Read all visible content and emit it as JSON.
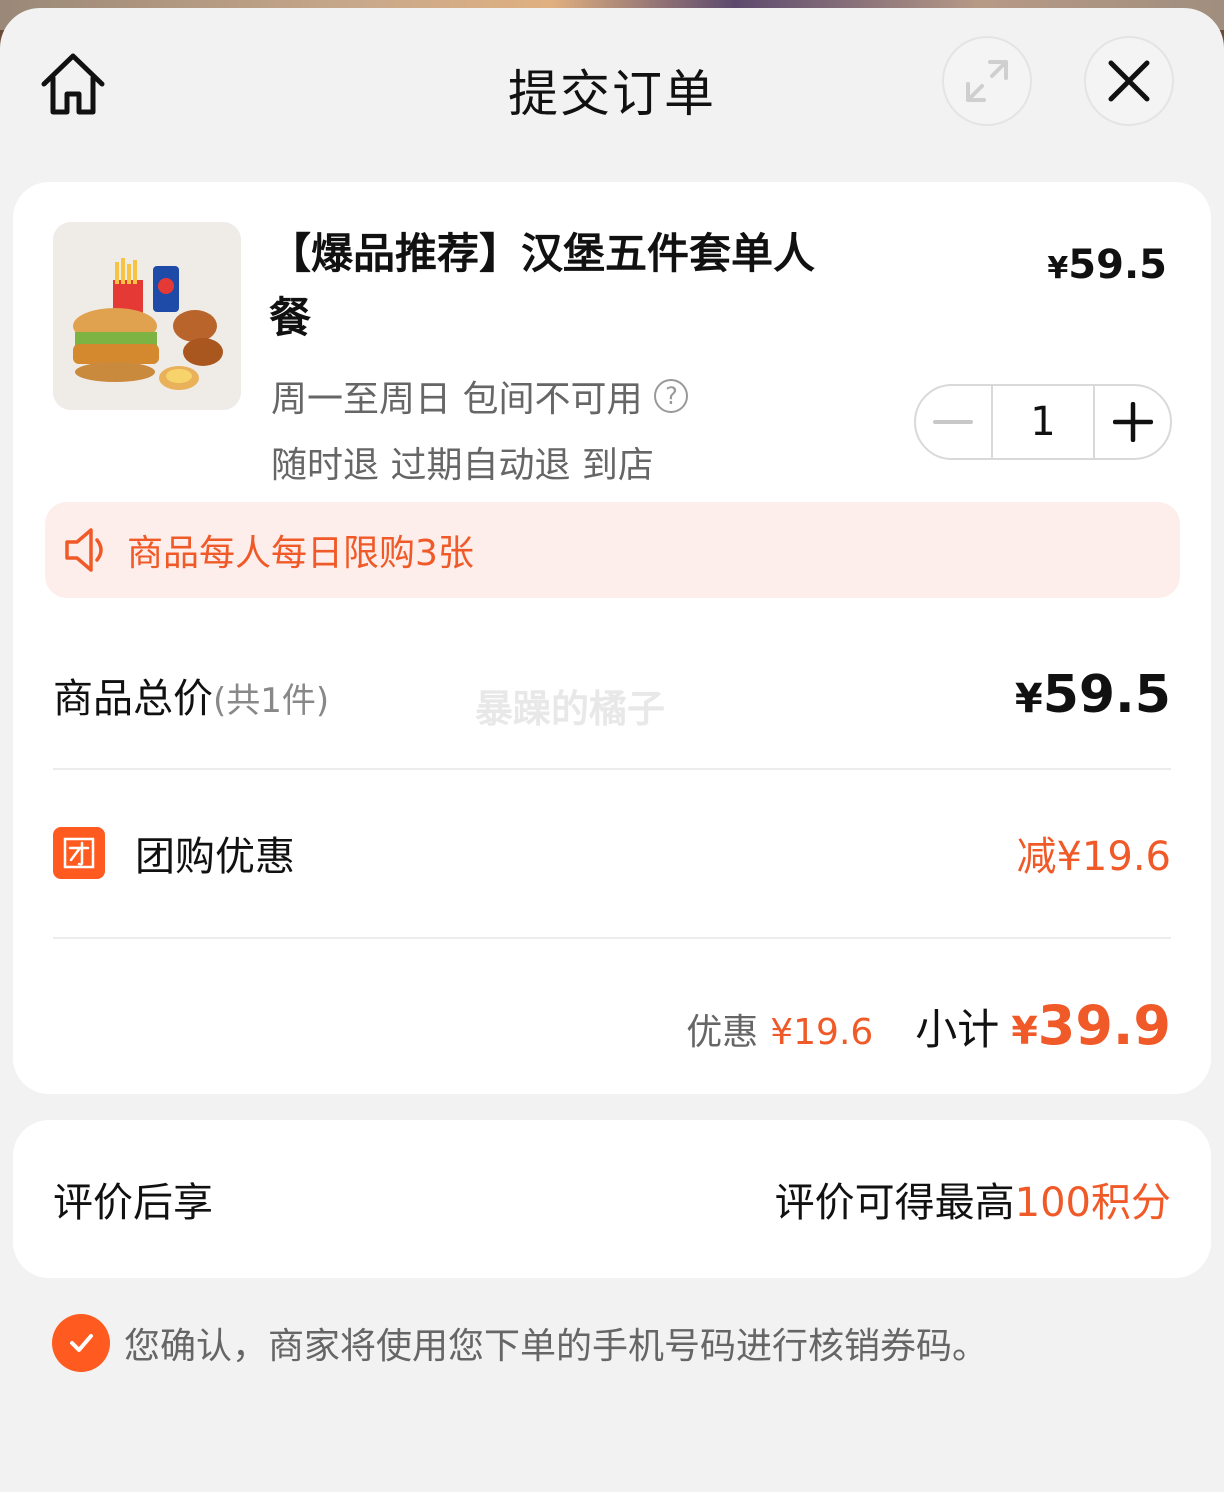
{
  "header": {
    "title": "提交订单"
  },
  "product": {
    "title": "【爆品推荐】汉堡五件套单人餐",
    "price_symbol": "¥",
    "price": "59.5",
    "tags_line1": "周一至周日 包间不可用",
    "tags_line2": "随时退 过期自动退 到店",
    "quantity": "1"
  },
  "notice": {
    "text": "商品每人每日限购3张"
  },
  "summary": {
    "total_label": "商品总价",
    "total_count": "(共1件)",
    "total_symbol": "¥",
    "total_value": "59.5",
    "watermark": "暴躁的橘子",
    "group_label": "团购优惠",
    "group_icon_text": "团",
    "group_discount": "减¥19.6",
    "discount_label": "优惠",
    "discount_amount": "¥19.6",
    "subtotal_label": "小计",
    "subtotal_symbol": "¥",
    "subtotal_value": "39.9"
  },
  "review": {
    "label": "评价后享",
    "right_text": "评价可得最高",
    "right_accent": "100积分"
  },
  "confirm": {
    "checked": true,
    "text": "您确认，商家将使用您下单的手机号码进行核销券码。"
  },
  "colors": {
    "accent": "#f05a28",
    "brand": "#ff5a1f",
    "notice_bg": "#fdeeeb",
    "sheet_bg": "#f2f2f2"
  },
  "icons": {
    "home": "home-icon",
    "expand": "expand-icon",
    "close": "close-icon",
    "help": "question-icon",
    "speaker": "speaker-icon",
    "minus": "minus-icon",
    "plus": "plus-icon",
    "check": "check-icon"
  }
}
